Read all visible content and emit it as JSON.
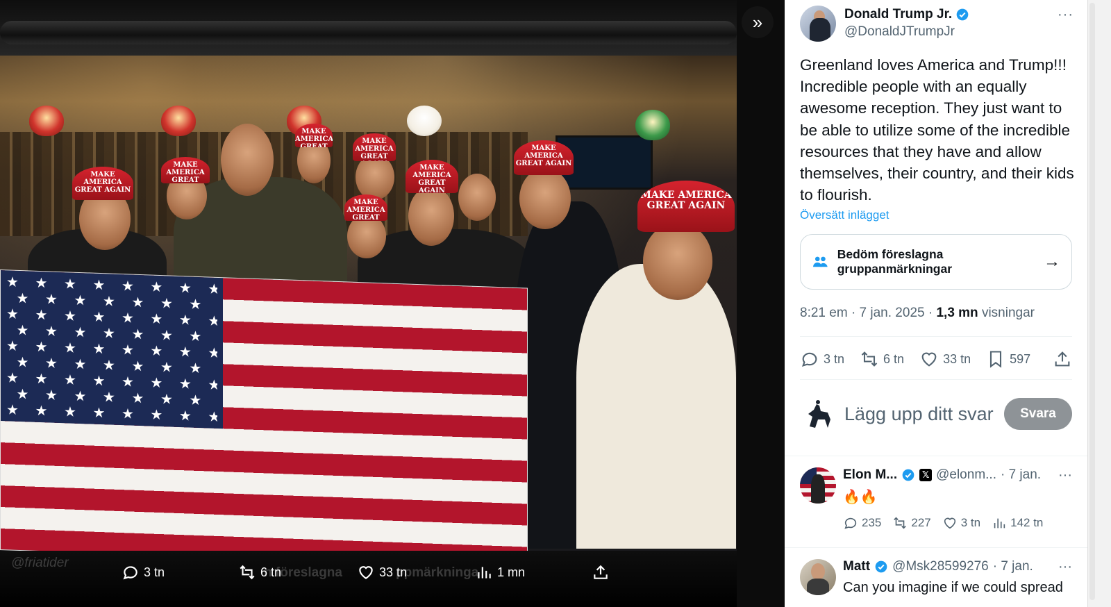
{
  "media": {
    "watermark": "@friatider",
    "cap_text": "MAKE AMERICA\nGREAT AGAIN",
    "actions": [
      {
        "icon": "reply-icon",
        "count": "3 tn"
      },
      {
        "icon": "repost-icon",
        "count": "6 tn"
      },
      {
        "icon": "like-icon",
        "count": "33 tn"
      },
      {
        "icon": "views-icon",
        "count": "1 mn"
      },
      {
        "icon": "share-icon",
        "count": ""
      }
    ],
    "ghost_labels": [
      "n föreslagna",
      "ppmärkninga"
    ],
    "collapse_label": "»"
  },
  "post": {
    "author": {
      "name": "Donald Trump Jr.",
      "handle": "@DonaldJTrumpJr"
    },
    "more": "···",
    "text": "Greenland loves America and Trump!!! Incredible people with an equally awesome reception. They just want to be able to utilize some of the incredible resources that they have and allow themselves, their country, and their kids to flourish.",
    "translate": "Översätt inlägget",
    "community_notes": {
      "label": "Bedöm föreslagna gruppanmärkningar",
      "arrow": "→"
    },
    "meta": {
      "time": "8:21 em",
      "date": "7 jan. 2025",
      "views_count": "1,3 mn",
      "views_label": "visningar",
      "sep": "·"
    },
    "stats": {
      "replies": "3 tn",
      "reposts": "6 tn",
      "likes": "33 tn",
      "bookmarks": "597"
    },
    "reply_box": {
      "placeholder": "Lägg upp ditt svar",
      "button": "Svara"
    }
  },
  "replies": [
    {
      "name": "Elon M...",
      "handle": "@elonm...",
      "date": "· 7 jan.",
      "text": "🔥🔥",
      "stats": {
        "replies": "235",
        "reposts": "227",
        "likes": "3 tn",
        "views": "142 tn"
      }
    },
    {
      "name": "Matt",
      "handle": "@Msk28599276",
      "date": "· 7 jan.",
      "text": "Can you imagine if we could spread"
    }
  ],
  "colors": {
    "accent": "#1d9bf0",
    "verified": "#1d9bf0",
    "secondary_text": "#536471",
    "reply_button": "#8e9397",
    "cap_red": "#c41e2a"
  }
}
